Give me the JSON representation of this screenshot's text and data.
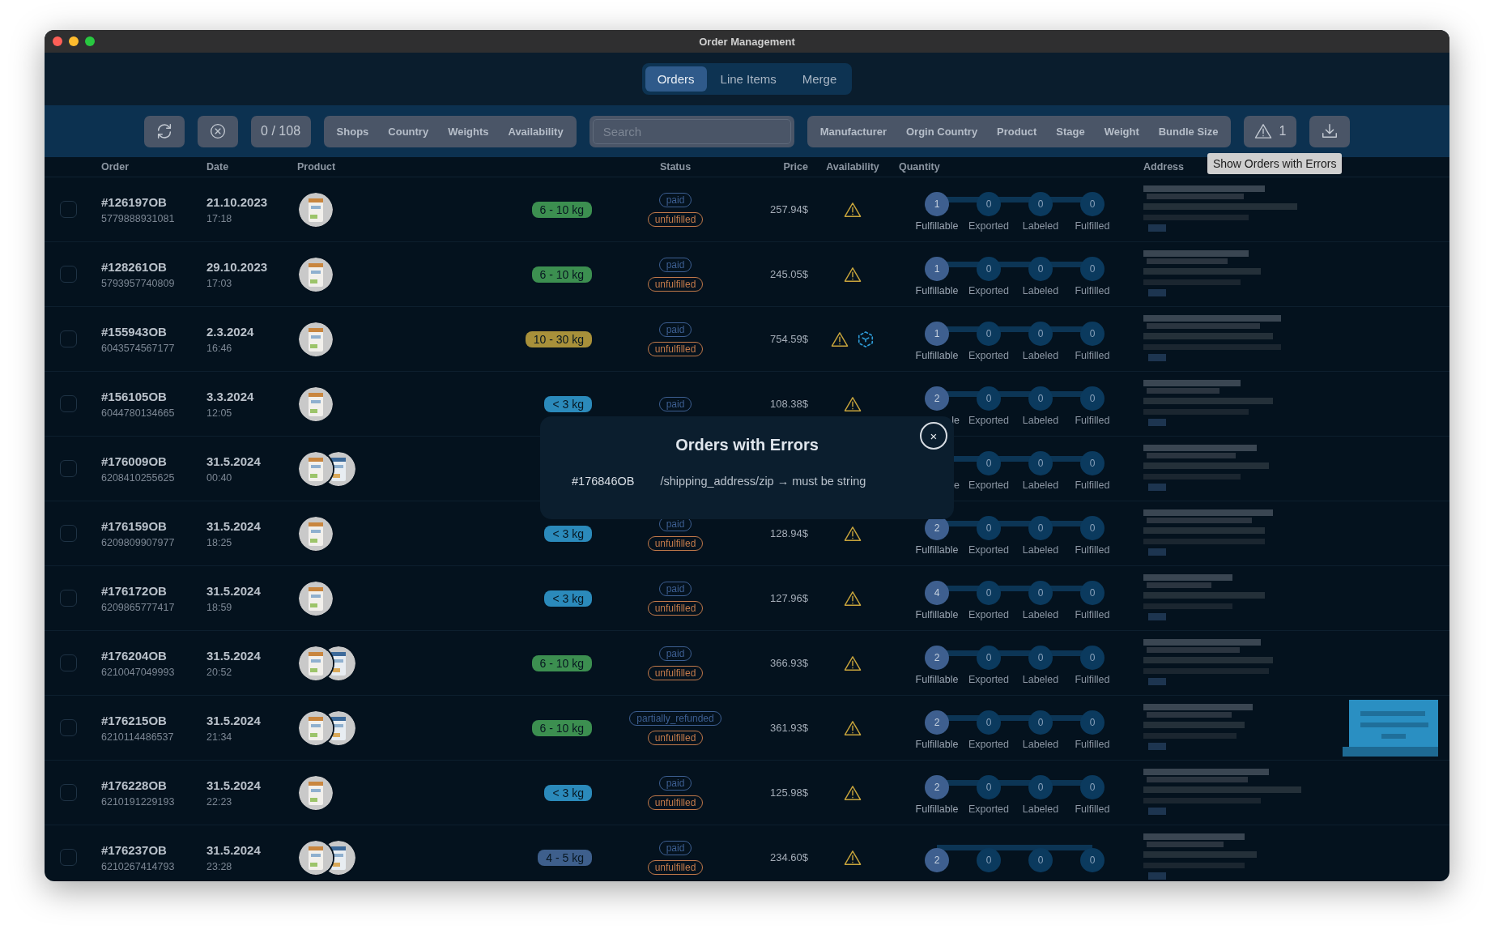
{
  "window": {
    "title": "Order Management"
  },
  "tabs": [
    {
      "label": "Orders",
      "selected": true
    },
    {
      "label": "Line Items",
      "selected": false
    },
    {
      "label": "Merge",
      "selected": false
    }
  ],
  "toolbar": {
    "count": "0 / 108",
    "filters_left": [
      "Shops",
      "Country",
      "Weights",
      "Availability"
    ],
    "search": {
      "placeholder": "Search"
    },
    "filters_right": [
      "Manufacturer",
      "Orgin Country",
      "Product",
      "Stage",
      "Weight",
      "Bundle Size"
    ],
    "error_count": "1",
    "tooltip": "Show Orders with Errors"
  },
  "table": {
    "columns": [
      "Order",
      "Date",
      "Product",
      "Status",
      "Price",
      "Availability",
      "Quantity",
      "Address"
    ],
    "rows": [
      {
        "checked": false,
        "order": "#126197OB",
        "order_id": "5779888931081",
        "date": "21.10.2023",
        "time": "17:18",
        "products": [
          {
            "kind": "picture"
          }
        ],
        "weight": {
          "text": "6 - 10 kg",
          "color": "#3c8f50"
        },
        "status": [
          {
            "text": "paid",
            "color": "#3d5f92"
          },
          {
            "text": "unfulfilled",
            "color": "#c27a4a"
          }
        ],
        "price": "257.94$",
        "availability": [
          {
            "kind": "warning"
          }
        ],
        "steps": [
          {
            "count": "1",
            "label": "Fulfillable",
            "active": true
          },
          {
            "count": "0",
            "label": "Exported",
            "active": false
          },
          {
            "count": "0",
            "label": "Labeled",
            "active": false
          },
          {
            "count": "0",
            "label": "Fulfilled",
            "active": false
          }
        ],
        "address_note": false
      },
      {
        "checked": false,
        "order": "#128261OB",
        "order_id": "5793957740809",
        "date": "29.10.2023",
        "time": "17:03",
        "products": [
          {
            "kind": "picture"
          }
        ],
        "weight": {
          "text": "6 - 10 kg",
          "color": "#3c8f50"
        },
        "status": [
          {
            "text": "paid",
            "color": "#3d5f92"
          },
          {
            "text": "unfulfilled",
            "color": "#c27a4a"
          }
        ],
        "price": "245.05$",
        "availability": [
          {
            "kind": "warning"
          }
        ],
        "steps": [
          {
            "count": "1",
            "label": "Fulfillable",
            "active": true
          },
          {
            "count": "0",
            "label": "Exported",
            "active": false
          },
          {
            "count": "0",
            "label": "Labeled",
            "active": false
          },
          {
            "count": "0",
            "label": "Fulfilled",
            "active": false
          }
        ],
        "address_note": false
      },
      {
        "checked": false,
        "order": "#155943OB",
        "order_id": "6043574567177",
        "date": "2.3.2024",
        "time": "16:46",
        "products": [
          {
            "kind": "picture"
          }
        ],
        "weight": {
          "text": "10 - 30 kg",
          "color": "#a8903a"
        },
        "status": [
          {
            "text": "paid",
            "color": "#3d5f92"
          },
          {
            "text": "unfulfilled",
            "color": "#c27a4a"
          }
        ],
        "price": "754.59$",
        "availability": [
          {
            "kind": "warning"
          },
          {
            "kind": "cube"
          }
        ],
        "steps": [
          {
            "count": "1",
            "label": "Fulfillable",
            "active": true
          },
          {
            "count": "0",
            "label": "Exported",
            "active": false
          },
          {
            "count": "0",
            "label": "Labeled",
            "active": false
          },
          {
            "count": "0",
            "label": "Fulfilled",
            "active": false
          }
        ],
        "address_note": false
      },
      {
        "checked": false,
        "order": "#156105OB",
        "order_id": "6044780134665",
        "date": "3.3.2024",
        "time": "12:05",
        "products": [
          {
            "kind": "picture"
          }
        ],
        "weight": {
          "text": "< 3 kg",
          "color": "#2b8abb"
        },
        "status": [
          {
            "text": "paid",
            "color": "#3d5f92"
          }
        ],
        "price": "108.38$",
        "availability": [
          {
            "kind": "warning"
          }
        ],
        "steps": [
          {
            "count": "2",
            "label": "le",
            "active": true,
            "clipped": true
          },
          {
            "count": "0",
            "label": "Exported",
            "active": false
          },
          {
            "count": "0",
            "label": "Labeled",
            "active": false
          },
          {
            "count": "0",
            "label": "Fulfilled",
            "active": false
          }
        ],
        "address_note": false
      },
      {
        "checked": false,
        "order": "#176009OB",
        "order_id": "6208410255625",
        "date": "31.5.2024",
        "time": "00:40",
        "products": [
          {
            "kind": "picture"
          },
          {
            "kind": "picture"
          }
        ],
        "status": [],
        "availability": [],
        "steps": [
          {
            "label": "e",
            "clipped": true
          },
          {
            "count": "0",
            "label": "Exported",
            "active": false
          },
          {
            "count": "0",
            "label": "Labeled",
            "active": false
          },
          {
            "count": "0",
            "label": "Fulfilled",
            "active": false
          }
        ],
        "address_note": false
      },
      {
        "checked": false,
        "order": "#176159OB",
        "order_id": "6209809907977",
        "date": "31.5.2024",
        "time": "18:25",
        "products": [
          {
            "kind": "picture"
          }
        ],
        "weight": {
          "text": "< 3 kg",
          "color": "#2b8abb"
        },
        "status": [
          {
            "text": "paid",
            "color": "#3d5f92"
          },
          {
            "text": "unfulfilled",
            "color": "#c27a4a"
          }
        ],
        "price": "128.94$",
        "availability": [
          {
            "kind": "warning"
          }
        ],
        "steps": [
          {
            "count": "2",
            "label": "Fulfillable",
            "active": true
          },
          {
            "count": "0",
            "label": "Exported",
            "active": false
          },
          {
            "count": "0",
            "label": "Labeled",
            "active": false
          },
          {
            "count": "0",
            "label": "Fulfilled",
            "active": false
          }
        ],
        "address_note": false
      },
      {
        "checked": false,
        "order": "#176172OB",
        "order_id": "6209865777417",
        "date": "31.5.2024",
        "time": "18:59",
        "products": [
          {
            "kind": "picture"
          }
        ],
        "weight": {
          "text": "< 3 kg",
          "color": "#2b8abb"
        },
        "status": [
          {
            "text": "paid",
            "color": "#3d5f92"
          },
          {
            "text": "unfulfilled",
            "color": "#c27a4a"
          }
        ],
        "price": "127.96$",
        "availability": [
          {
            "kind": "warning"
          }
        ],
        "steps": [
          {
            "count": "4",
            "label": "Fulfillable",
            "active": true
          },
          {
            "count": "0",
            "label": "Exported",
            "active": false
          },
          {
            "count": "0",
            "label": "Labeled",
            "active": false
          },
          {
            "count": "0",
            "label": "Fulfilled",
            "active": false
          }
        ],
        "address_note": false
      },
      {
        "checked": false,
        "order": "#176204OB",
        "order_id": "6210047049993",
        "date": "31.5.2024",
        "time": "20:52",
        "products": [
          {
            "kind": "picture"
          },
          {
            "kind": "picture"
          }
        ],
        "weight": {
          "text": "6 - 10 kg",
          "color": "#3c8f50"
        },
        "status": [
          {
            "text": "paid",
            "color": "#3d5f92"
          },
          {
            "text": "unfulfilled",
            "color": "#c27a4a"
          }
        ],
        "price": "366.93$",
        "availability": [
          {
            "kind": "warning"
          }
        ],
        "steps": [
          {
            "count": "2",
            "label": "Fulfillable",
            "active": true
          },
          {
            "count": "0",
            "label": "Exported",
            "active": false
          },
          {
            "count": "0",
            "label": "Labeled",
            "active": false
          },
          {
            "count": "0",
            "label": "Fulfilled",
            "active": false
          }
        ],
        "address_note": false
      },
      {
        "checked": false,
        "order": "#176215OB",
        "order_id": "6210114486537",
        "date": "31.5.2024",
        "time": "21:34",
        "products": [
          {
            "kind": "picture"
          },
          {
            "kind": "picture"
          }
        ],
        "weight": {
          "text": "6 - 10 kg",
          "color": "#3c8f50"
        },
        "status": [
          {
            "text": "partially_refunded",
            "color": "#3d5f92"
          },
          {
            "text": "unfulfilled",
            "color": "#c27a4a"
          }
        ],
        "price": "361.93$",
        "availability": [
          {
            "kind": "warning"
          }
        ],
        "steps": [
          {
            "count": "2",
            "label": "Fulfillable",
            "active": true
          },
          {
            "count": "0",
            "label": "Exported",
            "active": false
          },
          {
            "count": "0",
            "label": "Labeled",
            "active": false
          },
          {
            "count": "0",
            "label": "Fulfilled",
            "active": false
          }
        ],
        "address_note": true
      },
      {
        "checked": false,
        "order": "#176228OB",
        "order_id": "6210191229193",
        "date": "31.5.2024",
        "time": "22:23",
        "products": [
          {
            "kind": "picture"
          }
        ],
        "weight": {
          "text": "< 3 kg",
          "color": "#2b8abb"
        },
        "status": [
          {
            "text": "paid",
            "color": "#3d5f92"
          },
          {
            "text": "unfulfilled",
            "color": "#c27a4a"
          }
        ],
        "price": "125.98$",
        "availability": [
          {
            "kind": "warning"
          }
        ],
        "steps": [
          {
            "count": "2",
            "label": "Fulfillable",
            "active": true
          },
          {
            "count": "0",
            "label": "Exported",
            "active": false
          },
          {
            "count": "0",
            "label": "Labeled",
            "active": false
          },
          {
            "count": "0",
            "label": "Fulfilled",
            "active": false
          }
        ],
        "address_note": false
      },
      {
        "checked": false,
        "order": "#176237OB",
        "order_id": "6210267414793",
        "date": "31.5.2024",
        "time": "23:28",
        "products": [
          {
            "kind": "picture"
          },
          {
            "kind": "picture"
          }
        ],
        "weight": {
          "text": "4 - 5 kg",
          "color": "#3e5f8c"
        },
        "status": [
          {
            "text": "paid",
            "color": "#3d5f92"
          },
          {
            "text": "unfulfilled",
            "color": "#c27a4a"
          }
        ],
        "price": "234.60$",
        "availability": [
          {
            "kind": "warning"
          }
        ],
        "steps": [
          {
            "count": "2",
            "active": true
          },
          {
            "count": "0",
            "active": false
          },
          {
            "count": "0",
            "active": false
          },
          {
            "count": "0",
            "active": false
          }
        ],
        "address_note": false
      }
    ]
  },
  "modal": {
    "title": "Orders with Errors",
    "close": "×",
    "errors": [
      {
        "order": "#176846OB",
        "message": "/shipping_address/zip → must be string"
      }
    ]
  }
}
